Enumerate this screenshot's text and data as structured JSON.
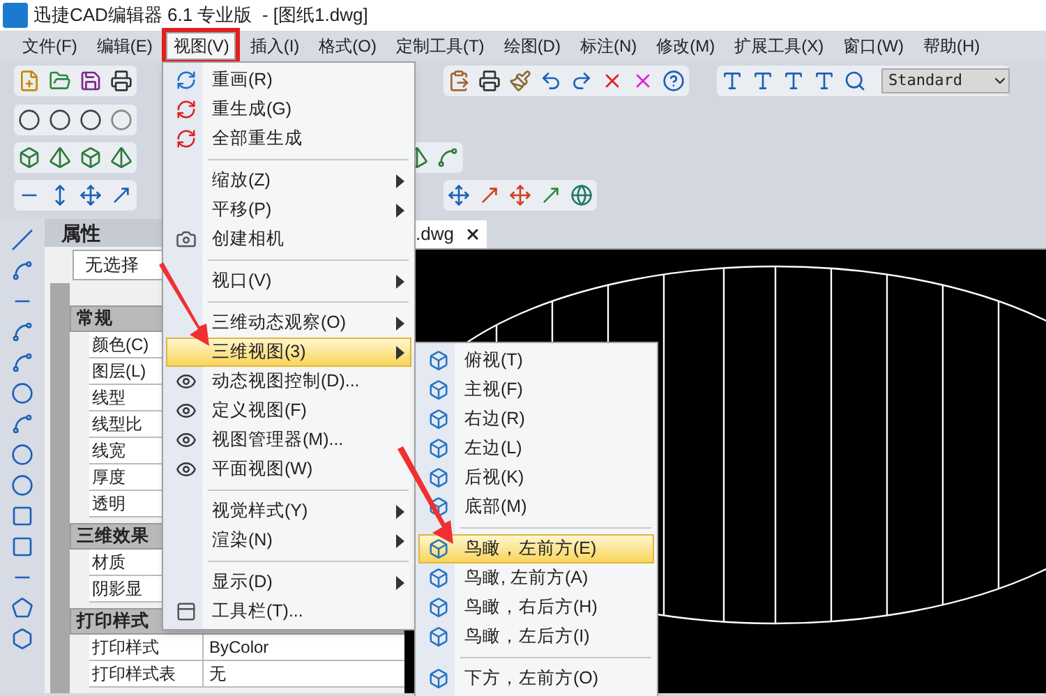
{
  "window": {
    "title": "迅捷CAD编辑器 6.1 专业版  - [图纸1.dwg]"
  },
  "menu_bar": [
    {
      "label": "文件(F)",
      "selected": false
    },
    {
      "label": "编辑(E)",
      "selected": false
    },
    {
      "label": "视图(V)",
      "selected": true
    },
    {
      "label": "插入(I)",
      "selected": false
    },
    {
      "label": "格式(O)",
      "selected": false
    },
    {
      "label": "定制工具(T)",
      "selected": false
    },
    {
      "label": "绘图(D)",
      "selected": false
    },
    {
      "label": "标注(N)",
      "selected": false
    },
    {
      "label": "修改(M)",
      "selected": false
    },
    {
      "label": "扩展工具(X)",
      "selected": false
    },
    {
      "label": "窗口(W)",
      "selected": false
    },
    {
      "label": "帮助(H)",
      "selected": false
    }
  ],
  "toolbar": {
    "text_style": "Standard"
  },
  "properties": {
    "title": "属性",
    "selection": "无选择",
    "groups": [
      {
        "title": "常规",
        "rows": [
          {
            "label": "颜色(C)"
          },
          {
            "label": "图层(L)"
          },
          {
            "label": "线型"
          },
          {
            "label": "线型比"
          },
          {
            "label": "线宽"
          },
          {
            "label": "厚度"
          },
          {
            "label": "透明"
          }
        ]
      },
      {
        "title": "三维效果",
        "rows": [
          {
            "label": "材质"
          },
          {
            "label": "阴影显"
          }
        ]
      },
      {
        "title": "打印样式",
        "rows": [
          {
            "label": "打印样式",
            "value": "ByColor"
          },
          {
            "label": "打印样式表",
            "value": "无"
          }
        ]
      }
    ]
  },
  "document_tab": {
    "label": ".dwg"
  },
  "view_menu": {
    "items": [
      {
        "kind": "item",
        "label": "重画(R)",
        "selected": false
      },
      {
        "kind": "item",
        "label": "重生成(G)",
        "selected": false
      },
      {
        "kind": "item",
        "label": "全部重生成",
        "selected": false
      },
      {
        "kind": "separator"
      },
      {
        "kind": "submenu",
        "label": "缩放(Z)",
        "selected": false
      },
      {
        "kind": "submenu",
        "label": "平移(P)",
        "selected": false
      },
      {
        "kind": "item",
        "label": "创建相机",
        "selected": false
      },
      {
        "kind": "separator"
      },
      {
        "kind": "submenu",
        "label": "视口(V)",
        "selected": false
      },
      {
        "kind": "separator"
      },
      {
        "kind": "submenu",
        "label": "三维动态观察(O)",
        "selected": false
      },
      {
        "kind": "submenu",
        "label": "三维视图(3)",
        "selected": true
      },
      {
        "kind": "item",
        "label": "动态视图控制(D)...",
        "selected": false
      },
      {
        "kind": "item",
        "label": "定义视图(F)",
        "selected": false
      },
      {
        "kind": "item",
        "label": "视图管理器(M)...",
        "selected": false
      },
      {
        "kind": "item",
        "label": "平面视图(W)",
        "selected": false
      },
      {
        "kind": "separator"
      },
      {
        "kind": "submenu",
        "label": "视觉样式(Y)",
        "selected": false
      },
      {
        "kind": "submenu",
        "label": "渲染(N)",
        "selected": false
      },
      {
        "kind": "separator"
      },
      {
        "kind": "submenu",
        "label": "显示(D)",
        "selected": false
      },
      {
        "kind": "item",
        "label": "工具栏(T)...",
        "selected": false
      }
    ]
  },
  "view_3d_menu": {
    "items": [
      {
        "kind": "item",
        "label": "俯视(T)",
        "selected": false
      },
      {
        "kind": "item",
        "label": "主视(F)",
        "selected": false
      },
      {
        "kind": "item",
        "label": "右边(R)",
        "selected": false
      },
      {
        "kind": "item",
        "label": "左边(L)",
        "selected": false
      },
      {
        "kind": "item",
        "label": "后视(K)",
        "selected": false
      },
      {
        "kind": "item",
        "label": "底部(M)",
        "selected": false
      },
      {
        "kind": "separator"
      },
      {
        "kind": "item",
        "label": "鸟瞰，左前方(E)",
        "selected": true
      },
      {
        "kind": "item",
        "label": "鸟瞰, 左前方(A)",
        "selected": false
      },
      {
        "kind": "item",
        "label": "鸟瞰，右后方(H)",
        "selected": false
      },
      {
        "kind": "item",
        "label": "鸟瞰，左后方(I)",
        "selected": false
      },
      {
        "kind": "separator"
      },
      {
        "kind": "item",
        "label": "下方，左前方(O)",
        "selected": false
      }
    ]
  }
}
